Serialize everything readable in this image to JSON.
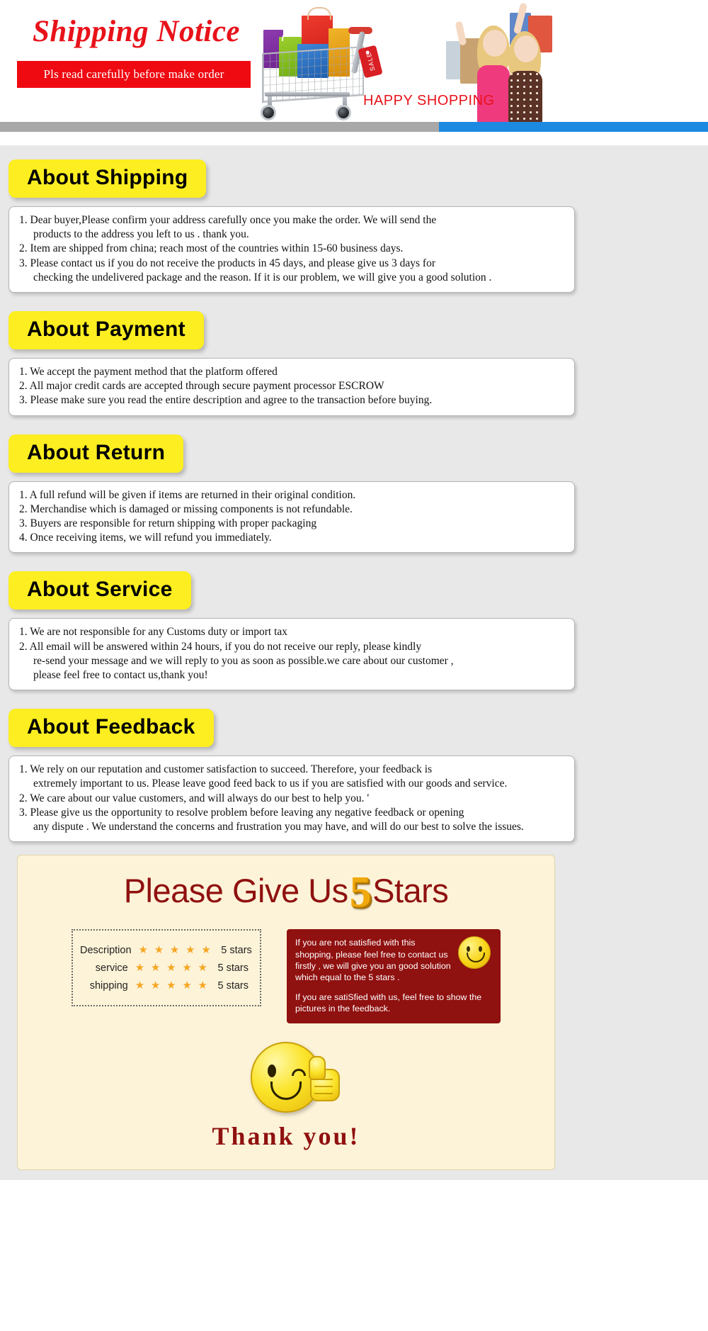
{
  "banner": {
    "title": "Shipping Notice",
    "subbar_text": "Pls read carefully before make order",
    "happy_shopping": "HAPPY SHOPPING",
    "sale_tag": "SALE",
    "accent_red": "#e8121a",
    "accent_blue": "#1c8ae0"
  },
  "sections": [
    {
      "badge": "About Shipping",
      "items": [
        {
          "num": "1.",
          "text": "Dear buyer,Please confirm your address carefully once you make the order. We will send the\nproducts to the address you left to us . thank you."
        },
        {
          "num": "2.",
          "text": "Item are shipped from china; reach most of the countries within 15-60 business days."
        },
        {
          "num": "3.",
          "text": "Please contact us if you do not receive the products in 45 days, and please give us 3 days for\nchecking the undelivered package and the reason. If it is our problem, we will give you a good solution ."
        }
      ]
    },
    {
      "badge": "About Payment",
      "items": [
        {
          "num": "1.",
          "text": "We accept the payment method that the platform offered"
        },
        {
          "num": "2.",
          "text": "All major credit cards are accepted through secure payment processor ESCROW"
        },
        {
          "num": "3.",
          "text": "Please make sure you read the entire description and agree to the transaction before buying."
        }
      ]
    },
    {
      "badge": "About Return",
      "items": [
        {
          "num": "1.",
          "text": "A full refund will be given if items are returned in their original condition."
        },
        {
          "num": "2.",
          "text": "Merchandise which is damaged or missing components is not refundable."
        },
        {
          "num": "3.",
          "text": "Buyers are responsible for return shipping with proper packaging"
        },
        {
          "num": "4.",
          "text": "Once receiving items, we will refund you immediately."
        }
      ]
    },
    {
      "badge": "About Service",
      "items": [
        {
          "num": "1.",
          "text": "We are not responsible for any Customs duty or import tax"
        },
        {
          "num": "2.",
          "text": "All email will be answered within 24 hours, if you do not receive our reply, please kindly\nre-send your message and we will reply to you as soon as possible.we care about our customer ,\nplease feel free to contact us,thank you!"
        }
      ]
    },
    {
      "badge": "About Feedback",
      "items": [
        {
          "num": "1.",
          "text": "We rely on our reputation and customer satisfaction to succeed. Therefore, your feedback is\nextremely important to us. Please leave good feed back to us if you are satisfied with our goods and service."
        },
        {
          "num": "2.",
          "text": "We care about our value customers, and will always do our best to help you. '"
        },
        {
          "num": "3.",
          "text": "Please give us the opportunity to resolve problem before leaving any negative feedback or opening\nany dispute . We understand the concerns and frustration you may have, and will do our best to solve the issues."
        }
      ]
    }
  ],
  "footer": {
    "headline_before": "Please Give Us",
    "headline_number": "5",
    "headline_after": "Stars",
    "ratings": [
      {
        "label": "Description",
        "stars": "★ ★ ★ ★ ★",
        "value": "5 stars"
      },
      {
        "label": "service",
        "stars": "★ ★ ★ ★ ★",
        "value": "5 stars"
      },
      {
        "label": "shipping",
        "stars": "★ ★ ★ ★ ★",
        "value": "5 stars"
      }
    ],
    "callout_first": "If you are not satisfied with this shopping, please feel free to contact us firstly , we will give you an good solution which equal to the 5 stars .",
    "callout_second": "If you are satiSfied with us, feel free to show the pictures in the feedback.",
    "thank_you": "Thank you!",
    "panel_bg": "#fdf3d8",
    "callout_bg": "#8f1110",
    "star_color": "#f5a623"
  }
}
